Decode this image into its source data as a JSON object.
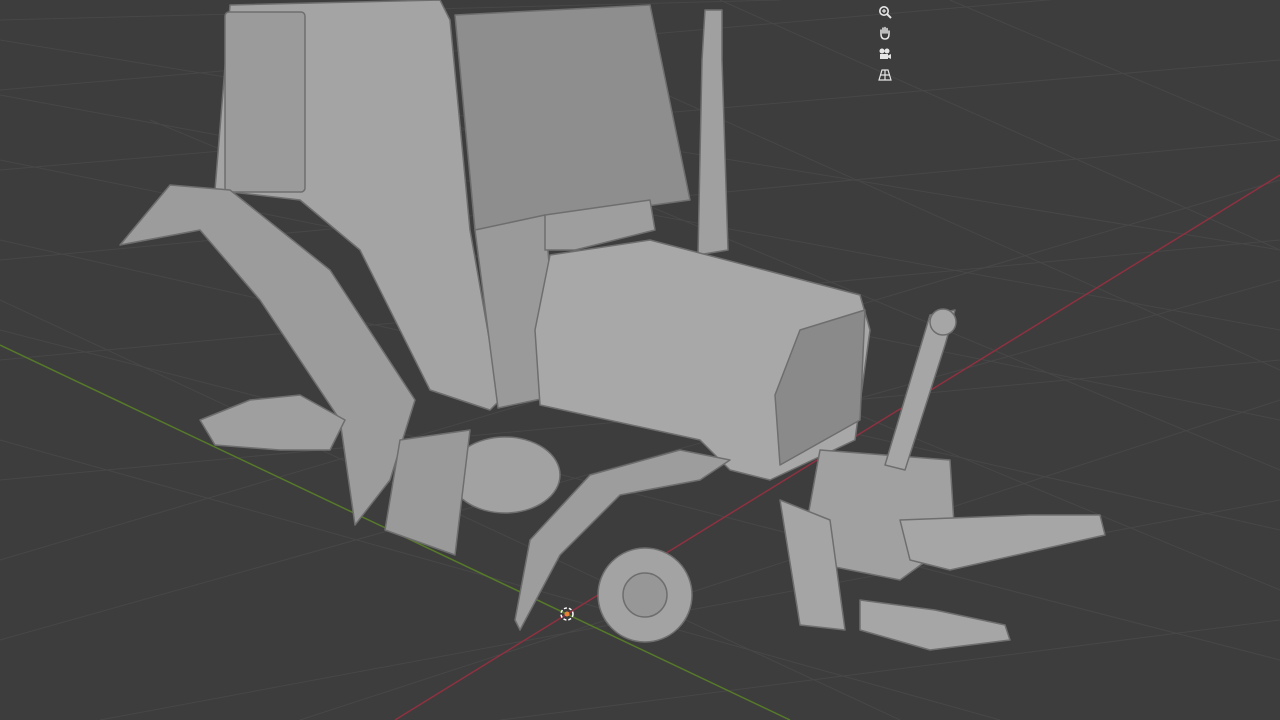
{
  "viewport": {
    "background": "#3d3d3d",
    "grid_color": "#4a4a4a",
    "x_axis_color": "#b3374a",
    "y_axis_color": "#6a9a2a",
    "model_color": "#a9a9a9"
  },
  "navigation_gizmos": [
    {
      "name": "zoom-icon"
    },
    {
      "name": "hand-pan-icon"
    },
    {
      "name": "camera-view-icon"
    },
    {
      "name": "perspective-grid-icon"
    }
  ],
  "scene_object": {
    "name": "tractor-model"
  }
}
